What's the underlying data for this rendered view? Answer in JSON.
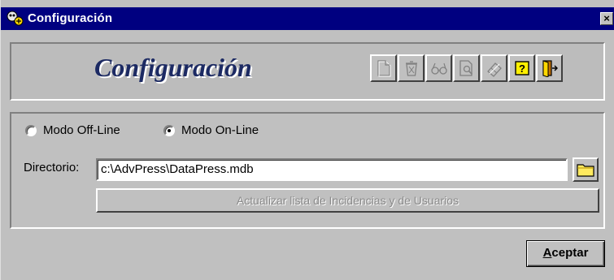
{
  "window": {
    "title": "Configuración",
    "close_label": "×"
  },
  "header": {
    "title": "Configuración",
    "toolbar": [
      {
        "icon": "new-document-icon",
        "enabled": false
      },
      {
        "icon": "delete-icon",
        "enabled": false
      },
      {
        "icon": "glasses-icon",
        "enabled": false
      },
      {
        "icon": "print-preview-icon",
        "enabled": false
      },
      {
        "icon": "eraser-icon",
        "enabled": false
      },
      {
        "icon": "help-icon",
        "enabled": true
      },
      {
        "icon": "exit-door-icon",
        "enabled": true
      }
    ]
  },
  "mode": {
    "options": [
      {
        "label": "Modo Off-Line",
        "checked": false
      },
      {
        "label": "Modo On-Line",
        "checked": true
      }
    ]
  },
  "directory": {
    "label": "Directorio:",
    "value": "c:\\AdvPress\\DataPress.mdb"
  },
  "update_button": {
    "label": "Actualizar lista de Incidencias y de Usuarios",
    "enabled": false
  },
  "accept_button": {
    "label": "Aceptar"
  },
  "colors": {
    "titlebar": "#000080",
    "face": "#c0c0c0",
    "header_title": "#1c2a63"
  }
}
